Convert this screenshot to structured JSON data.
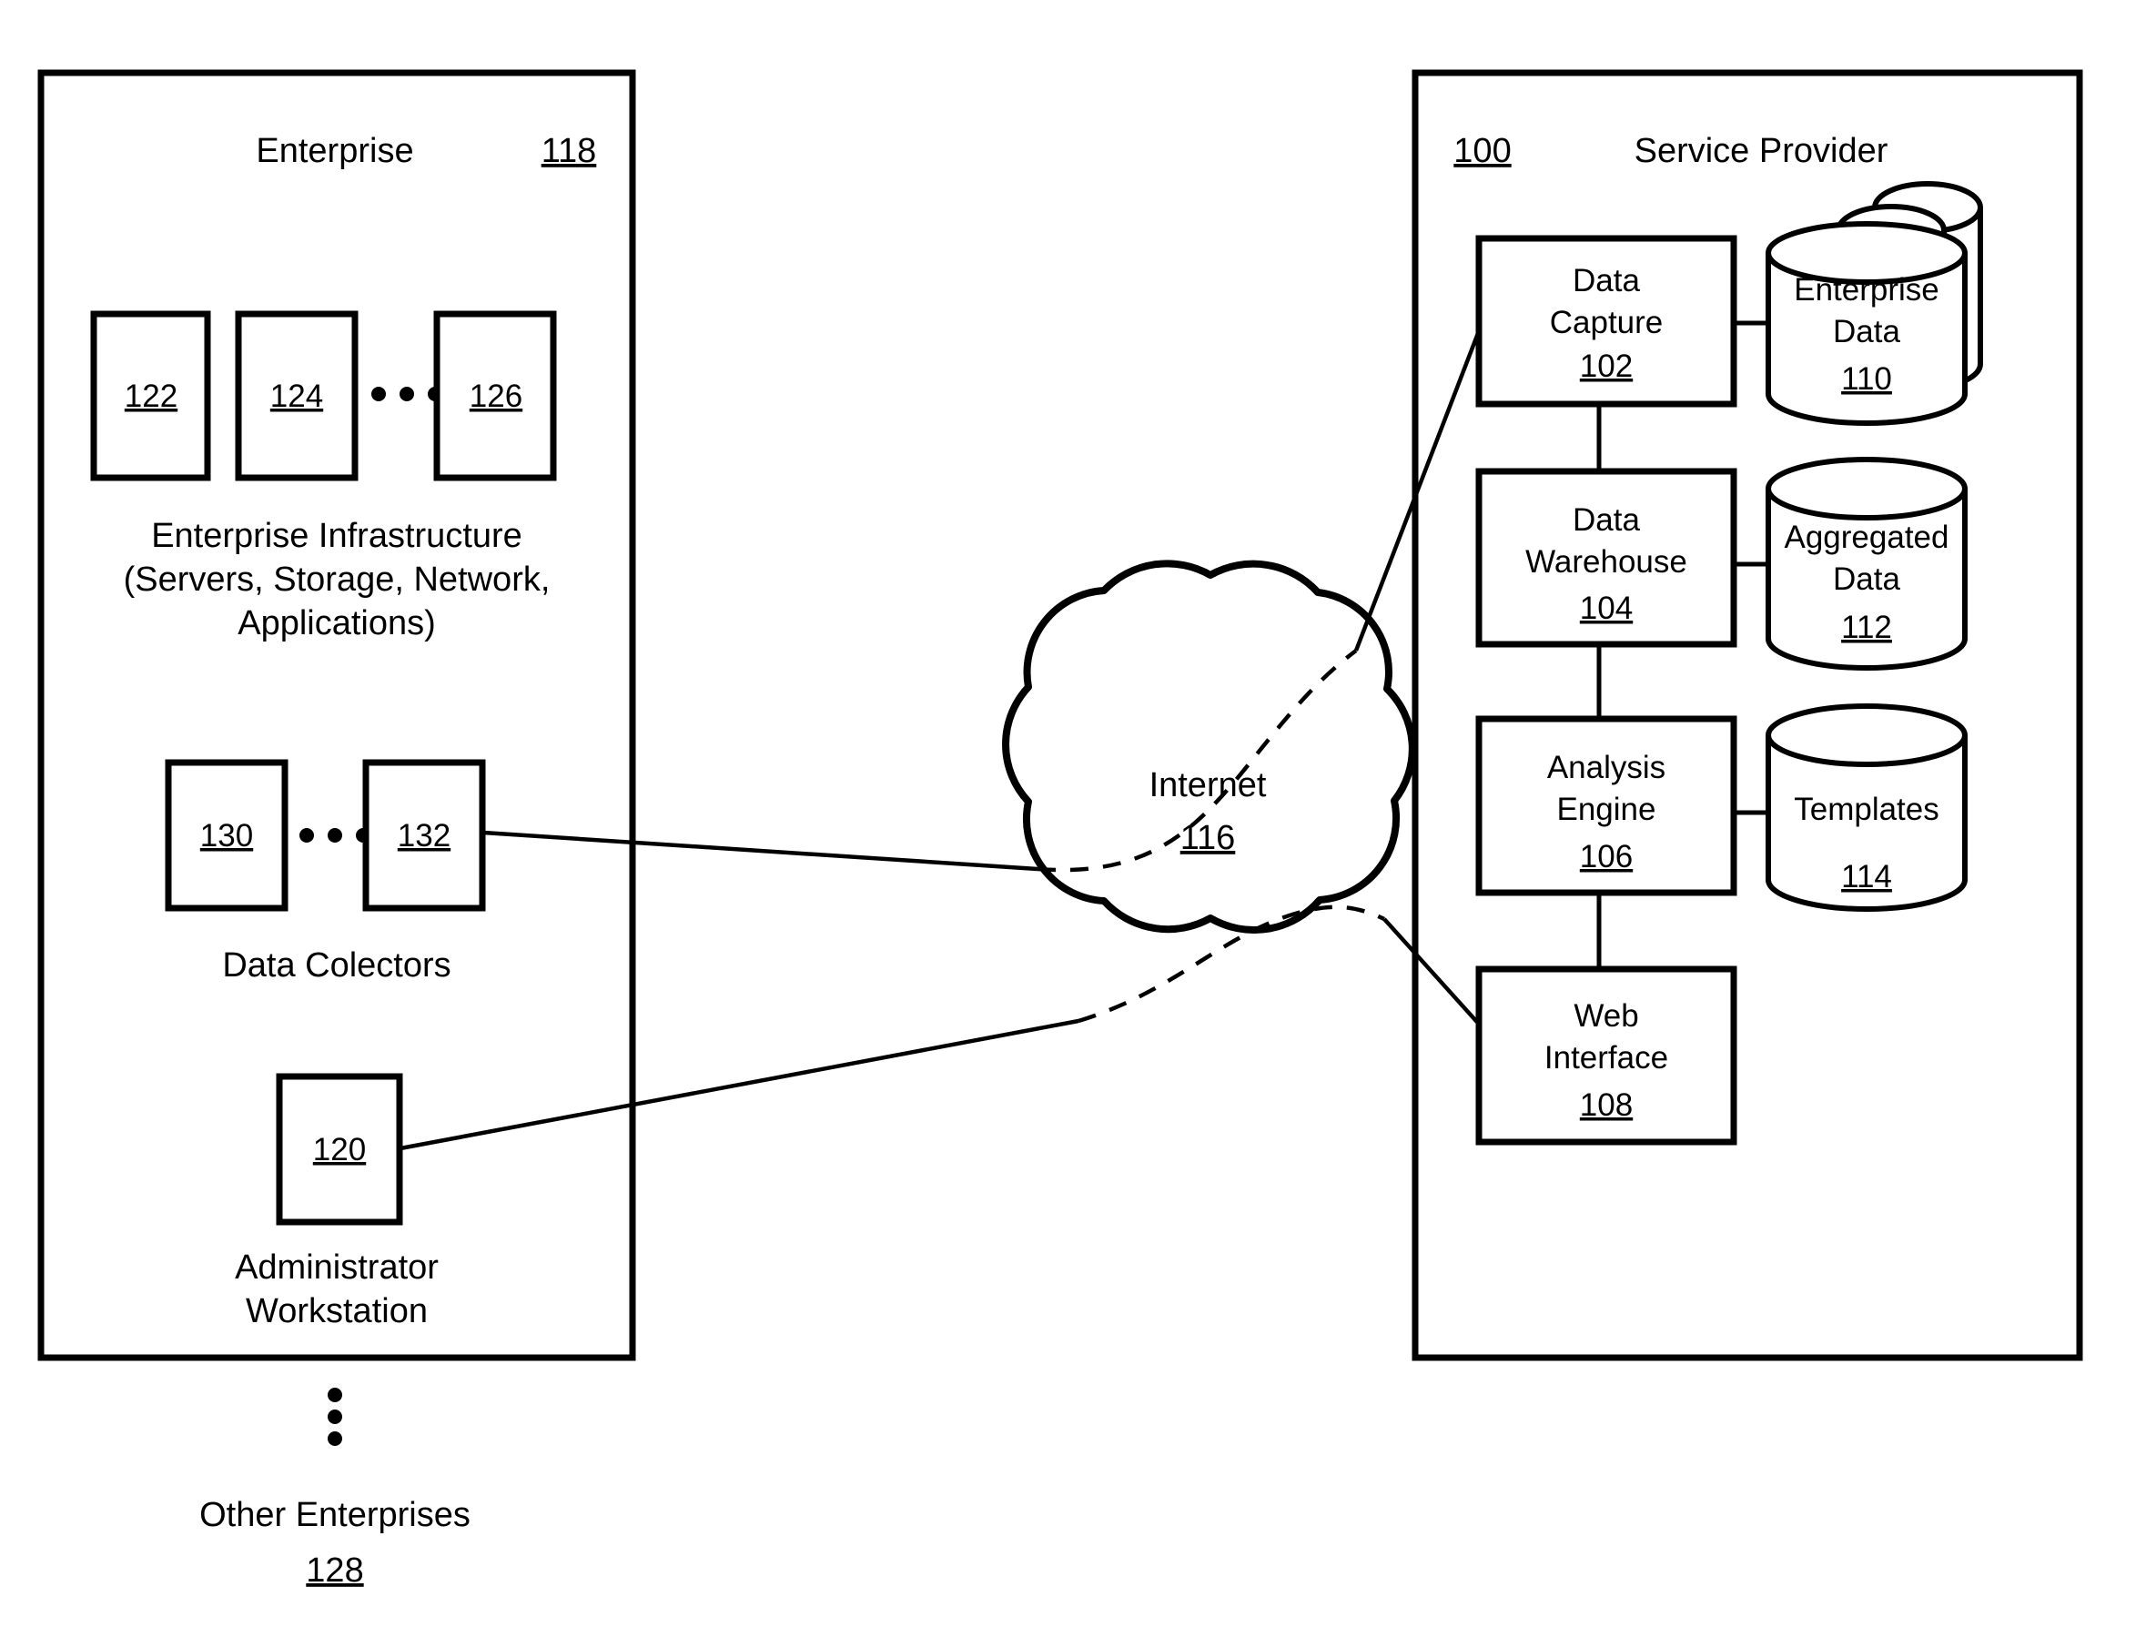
{
  "figure": {
    "title": "Enterprise / Service Provider System Diagram",
    "enterprise_panel": {
      "heading": "Enterprise",
      "ref": "118",
      "infrastructure": {
        "boxes": [
          {
            "ref": "122"
          },
          {
            "ref": "124"
          },
          {
            "ref": "126"
          }
        ],
        "ellipsis": "• • •",
        "caption_line1": "Enterprise Infrastructure",
        "caption_line2": "(Servers, Storage, Network,",
        "caption_line3": "Applications)"
      },
      "collectors": {
        "boxes": [
          {
            "ref": "130"
          },
          {
            "ref": "132"
          }
        ],
        "ellipsis": "• • •",
        "caption": "Data Colectors"
      },
      "workstation": {
        "ref": "120",
        "caption_line1": "Administrator",
        "caption_line2": "Workstation"
      }
    },
    "other_enterprises": {
      "caption": "Other Enterprises",
      "ref": "128",
      "vertical_ellipsis": "⋮"
    },
    "internet": {
      "label": "Internet",
      "ref": "116"
    },
    "service_panel": {
      "heading": "Service Provider",
      "ref": "100",
      "nodes": [
        {
          "name": "data-capture",
          "line1": "Data",
          "line2": "Capture",
          "ref": "102"
        },
        {
          "name": "data-warehouse",
          "line1": "Data",
          "line2": "Warehouse",
          "ref": "104"
        },
        {
          "name": "analysis-engine",
          "line1": "Analysis",
          "line2": "Engine",
          "ref": "106"
        },
        {
          "name": "web-interface",
          "line1": "Web",
          "line2": "Interface",
          "ref": "108"
        }
      ],
      "stores": [
        {
          "name": "enterprise-data",
          "line1": "Enterprise",
          "line2": "Data",
          "ref": "110",
          "stacked": true
        },
        {
          "name": "aggregated-data",
          "line1": "Aggregated",
          "line2": "Data",
          "ref": "112",
          "stacked": false
        },
        {
          "name": "templates",
          "line1": "Templates",
          "line2": "",
          "ref": "114",
          "stacked": false
        }
      ]
    },
    "colors": {
      "ink": "#000000",
      "paper": "#ffffff"
    }
  }
}
